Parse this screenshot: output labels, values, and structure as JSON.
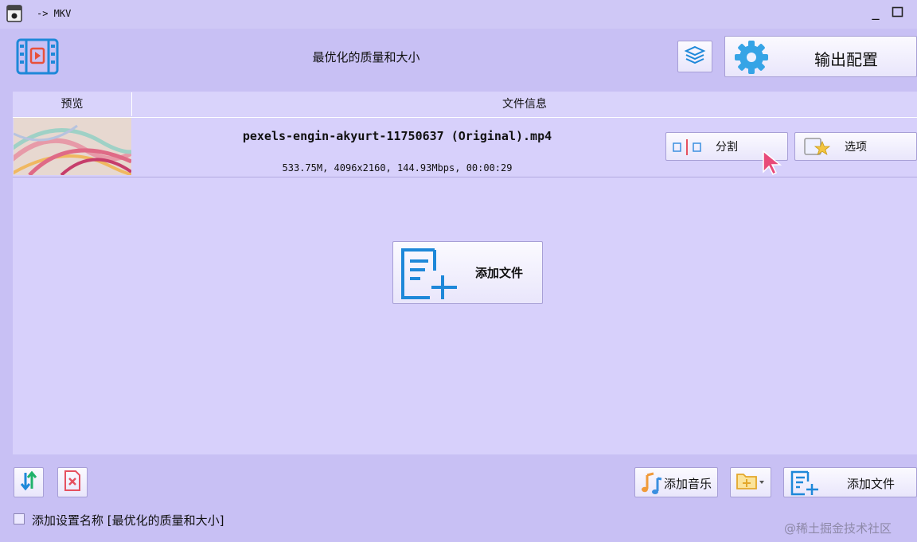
{
  "window": {
    "title": "-> MKV",
    "minimize_glyph": "_"
  },
  "header": {
    "profile_title": "最优化的质量和大小",
    "config_label": "输出配置"
  },
  "table": {
    "columns": [
      "预览",
      "文件信息"
    ],
    "rows": [
      {
        "file_name": "pexels-engin-akyurt-11750637 (Original).mp4",
        "meta": "533.75M, 4096x2160, 144.93Mbps, 00:00:29",
        "split_label": "分割",
        "options_label": "选项"
      }
    ],
    "add_file_label": "添加文件"
  },
  "footer": {
    "add_music_label": "添加音乐",
    "add_file_label": "添加文件",
    "setting_name_label": "添加设置名称 [最优化的质量和大小]",
    "setting_name_checked": false
  },
  "watermark": "@稀土掘金技术社区",
  "icons": {
    "app": "video-app-icon",
    "film": "film-play-icon",
    "layers": "layers-icon",
    "gear": "gear-icon",
    "split": "split-icon",
    "options": "options-star-icon",
    "add": "add-file-icon",
    "sort": "sort-icon",
    "remove": "remove-icon",
    "music": "music-note-icon",
    "folder": "folder-add-icon",
    "cursor": "mouse-cursor-icon"
  },
  "colors": {
    "background": "#c8c0f4",
    "accent_blue": "#1e88d9",
    "accent_red": "#e5505f",
    "gear_blue": "#36a4e6"
  }
}
